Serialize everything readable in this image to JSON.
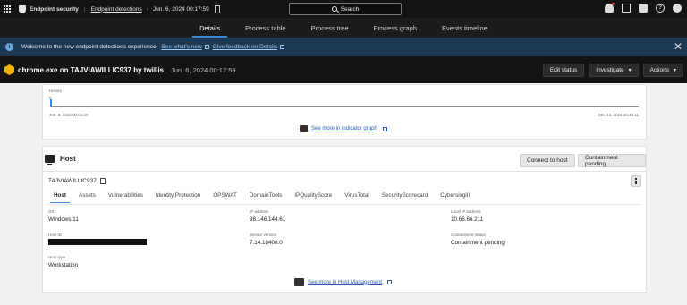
{
  "topbar": {
    "product": "Endpoint security",
    "breadcrumb": "Endpoint detections",
    "crumb_date": "Jun. 6, 2024 00:17:59",
    "search_label": "Search"
  },
  "tabs": [
    "Details",
    "Process table",
    "Process tree",
    "Process graph",
    "Events timeline"
  ],
  "banner": {
    "message": "Welcome to the new endpoint detections experience.",
    "link1": "See what's new",
    "link2": "Give feedback on Details"
  },
  "header": {
    "title": "chrome.exe on TAJVIAWILLIC937 by twillis",
    "date": "Jun. 6, 2024 00:17:59",
    "btn_edit": "Edit status",
    "btn_investigate": "Investigate",
    "btn_actions": "Actions"
  },
  "timeline": {
    "top_label": "History",
    "value_label": "0",
    "start": "Jun. 6, 2024 00:01:00",
    "end": "Jun. 13, 2024 10:36:11",
    "link": "See more in indicator graph"
  },
  "host": {
    "section_title": "Host",
    "btn_connect": "Connect to host",
    "btn_containment": "Containment pending",
    "hostname": "TAJVIAWILLIC937",
    "subtabs": [
      "Host",
      "Assets",
      "Vulnerabilities",
      "Identity Protection",
      "OPSWAT",
      "DomainTools",
      "IPQualityScore",
      "VirusTotal",
      "SecurityScorecard",
      "CybersixgiII"
    ],
    "fields": {
      "os_label": "OS",
      "os": "Windows 11",
      "ip_label": "IP address",
      "ip": "98.146.144.61",
      "lip_label": "Local IP address",
      "lip": "10.66.66.211",
      "hostid_label": "Host ID",
      "sensor_label": "Sensor version",
      "sensor": "7.14.18408.0",
      "contain_label": "Containment status",
      "contain": "Containment pending",
      "type_label": "Host type",
      "type": "Workstation"
    },
    "link": "See more in Host Management"
  }
}
